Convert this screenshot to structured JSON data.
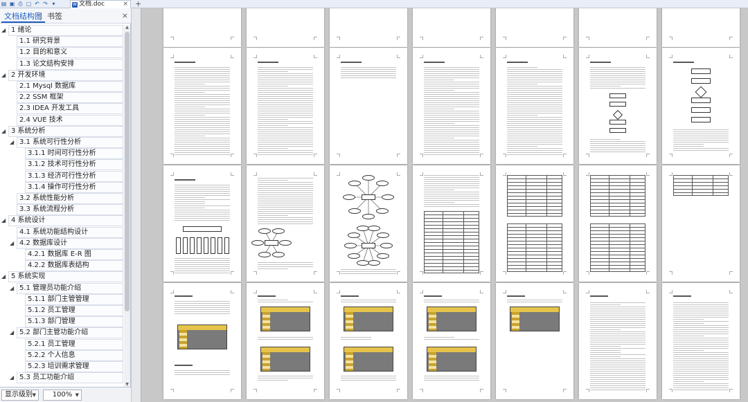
{
  "titlebar": {
    "document_tab": "文档.doc",
    "icons": [
      "app-menu-icon",
      "save-icon",
      "print-icon",
      "print-preview-icon",
      "undo-icon",
      "redo-icon",
      "dropdown-icon"
    ]
  },
  "sidebar": {
    "tabs": [
      {
        "label": "文档结构图",
        "active": true
      },
      {
        "label": "书签",
        "active": false
      }
    ],
    "toc": [
      {
        "text": "1  绪论",
        "level": 1,
        "expand": "open"
      },
      {
        "text": "1.1 研究背景",
        "level": 2
      },
      {
        "text": "1.2 目的和意义",
        "level": 2
      },
      {
        "text": "1.3 论文结构安排",
        "level": 2
      },
      {
        "text": "2  开发环境",
        "level": 1,
        "expand": "open"
      },
      {
        "text": "2.1 Mysql 数据库",
        "level": 2
      },
      {
        "text": "2.2 SSM 框架",
        "level": 2
      },
      {
        "text": "2.3 IDEA  开发工具",
        "level": 2
      },
      {
        "text": "2.4 VUE 技术",
        "level": 2
      },
      {
        "text": "3  系统分析",
        "level": 1,
        "expand": "open"
      },
      {
        "text": "3.1 系统可行性分析",
        "level": 2,
        "expand": "open"
      },
      {
        "text": "3.1.1  时间可行性分析",
        "level": 3
      },
      {
        "text": "3.1.2  技术可行性分析",
        "level": 3
      },
      {
        "text": "3.1.3  经济可行性分析",
        "level": 3
      },
      {
        "text": "3.1.4  操作可行性分析",
        "level": 3
      },
      {
        "text": "3.2 系统性能分析",
        "level": 2
      },
      {
        "text": "3.3 系统流程分析",
        "level": 2
      },
      {
        "text": "4  系统设计",
        "level": 1,
        "expand": "open"
      },
      {
        "text": "4.1 系统功能结构设计",
        "level": 2
      },
      {
        "text": "4.2 数据库设计",
        "level": 2,
        "expand": "open"
      },
      {
        "text": "4.2.1 数据库 E-R 图",
        "level": 3
      },
      {
        "text": "4.2.2  数据库表结构",
        "level": 3
      },
      {
        "text": "5  系统实现",
        "level": 1,
        "expand": "open"
      },
      {
        "text": "5.1  管理员功能介绍",
        "level": 2,
        "expand": "open"
      },
      {
        "text": "5.1.1 部门主管管理",
        "level": 3
      },
      {
        "text": "5.1.2  员工管理",
        "level": 3
      },
      {
        "text": "5.1.3  部门管理",
        "level": 3
      },
      {
        "text": "5.2  部门主管功能介绍",
        "level": 2,
        "expand": "open"
      },
      {
        "text": "5.2.1 员工管理",
        "level": 3
      },
      {
        "text": "5.2.2 个人信息",
        "level": 3
      },
      {
        "text": "5.2.3 培训需求管理",
        "level": 3
      },
      {
        "text": "5.3  员工功能介绍",
        "level": 2,
        "expand": "open"
      }
    ]
  },
  "statusbar": {
    "level_label": "显示级别",
    "zoom": "100%"
  },
  "document": {
    "layout": "multi-page thumbnail view",
    "rows": 4,
    "columns": 8
  }
}
